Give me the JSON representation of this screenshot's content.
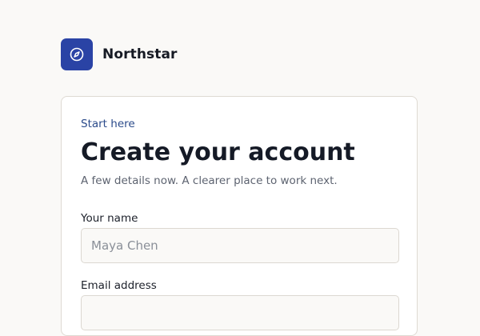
{
  "brand": {
    "name": "Northstar",
    "icon": "compass-icon",
    "color": "#2a43a5"
  },
  "form": {
    "eyebrow": "Start here",
    "title": "Create your account",
    "subtitle": "A few details now. A clearer place to work next.",
    "name_label": "Your name",
    "name_placeholder": "Maya Chen",
    "email_label": "Email address"
  },
  "colors": {
    "accent": "#2a4a8a",
    "background": "#faf9f7"
  }
}
